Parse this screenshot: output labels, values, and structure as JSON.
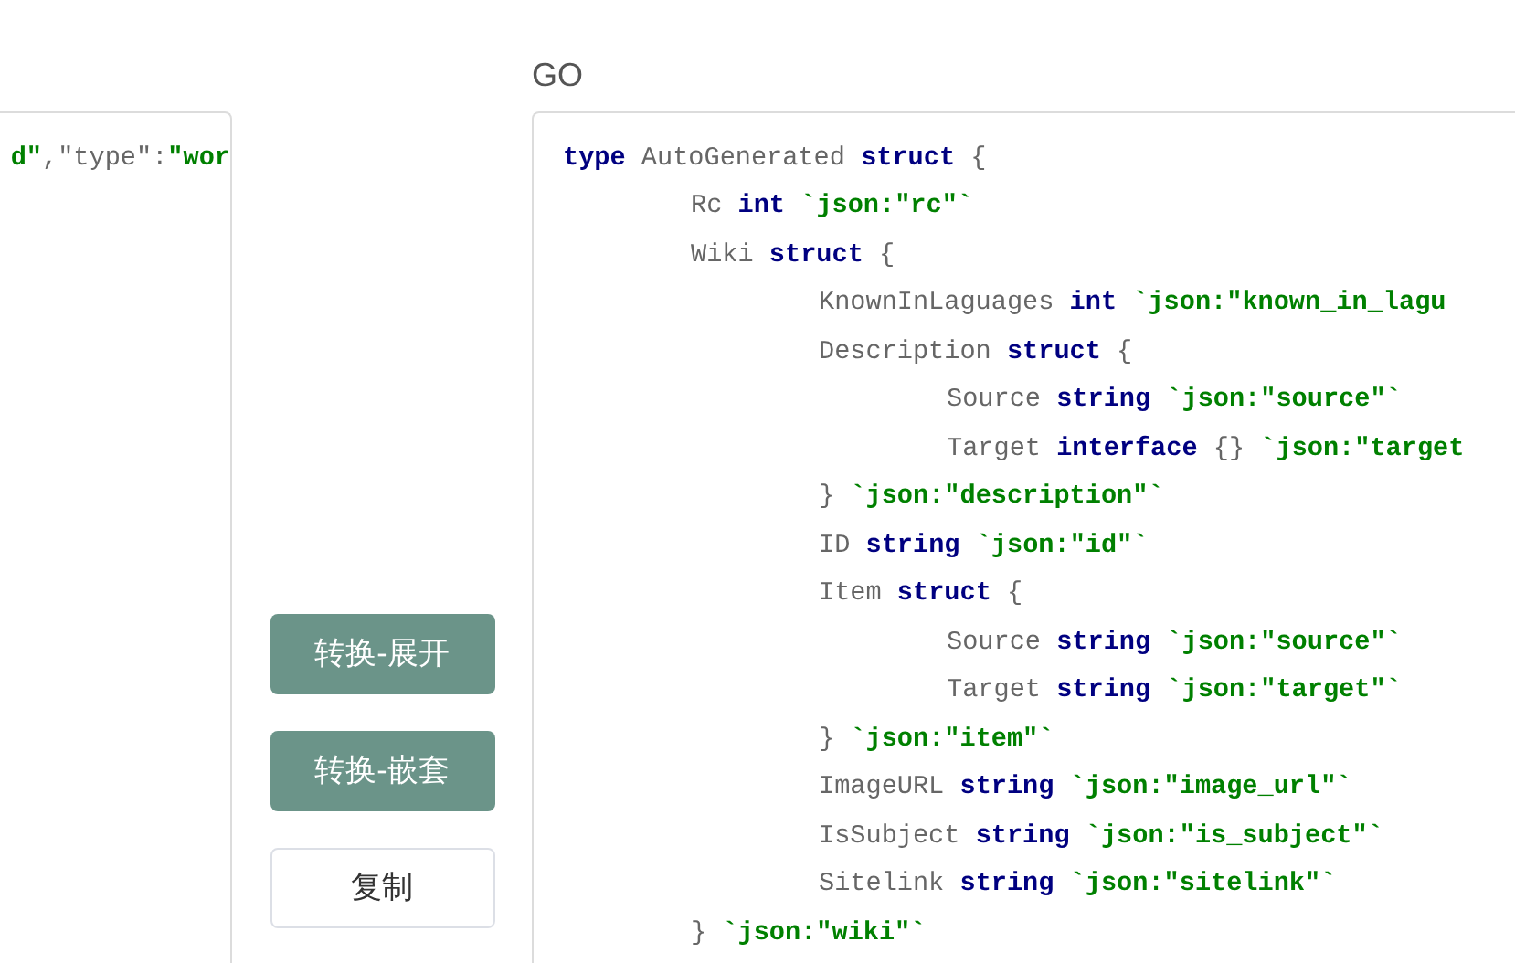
{
  "input_panel": {
    "tokens": [
      {
        "kind": "string",
        "text": "d\""
      },
      {
        "kind": "punct",
        "text": ","
      },
      {
        "kind": "name",
        "text": "\"type\""
      },
      {
        "kind": "punct",
        "text": ":"
      },
      {
        "kind": "string",
        "text": "\"wor"
      }
    ]
  },
  "buttons": [
    {
      "label": "转换-展开",
      "kind": "primary"
    },
    {
      "label": "转换-嵌套",
      "kind": "primary"
    },
    {
      "label": "复制",
      "kind": "secondary"
    }
  ],
  "output_panel": {
    "title": "GO",
    "lines": [
      {
        "tokens": [
          {
            "kind": "keyword",
            "text": "type"
          },
          {
            "kind": "name",
            "text": "AutoGenerated"
          },
          {
            "kind": "keyword",
            "text": "struct"
          },
          {
            "kind": "punct",
            "text": "{"
          }
        ],
        "children": [
          {
            "tokens": [
              {
                "kind": "name",
                "text": "Rc"
              },
              {
                "kind": "keyword",
                "text": "int"
              },
              {
                "kind": "tag",
                "text": "`json:\"rc\"`"
              }
            ]
          },
          {
            "tokens": [
              {
                "kind": "name",
                "text": "Wiki"
              },
              {
                "kind": "keyword",
                "text": "struct"
              },
              {
                "kind": "punct",
                "text": "{"
              }
            ],
            "children": [
              {
                "tokens": [
                  {
                    "kind": "name",
                    "text": "KnownInLaguages"
                  },
                  {
                    "kind": "keyword",
                    "text": "int"
                  },
                  {
                    "kind": "tag",
                    "text": "`json:\"known_in_lagu"
                  }
                ]
              },
              {
                "tokens": [
                  {
                    "kind": "name",
                    "text": "Description"
                  },
                  {
                    "kind": "keyword",
                    "text": "struct"
                  },
                  {
                    "kind": "punct",
                    "text": "{"
                  }
                ],
                "children": [
                  {
                    "tokens": [
                      {
                        "kind": "name",
                        "text": "Source"
                      },
                      {
                        "kind": "keyword",
                        "text": "string"
                      },
                      {
                        "kind": "tag",
                        "text": "`json:\"source\"`"
                      }
                    ]
                  },
                  {
                    "tokens": [
                      {
                        "kind": "name",
                        "text": "Target"
                      },
                      {
                        "kind": "keyword",
                        "text": "interface"
                      },
                      {
                        "kind": "punct",
                        "text": "{}"
                      },
                      {
                        "kind": "tag",
                        "text": "`json:\"target"
                      }
                    ]
                  }
                ]
              },
              {
                "tokens": [
                  {
                    "kind": "punct",
                    "text": "}"
                  },
                  {
                    "kind": "tag",
                    "text": "`json:\"description\"`"
                  }
                ]
              },
              {
                "tokens": [
                  {
                    "kind": "name",
                    "text": "ID"
                  },
                  {
                    "kind": "keyword",
                    "text": "string"
                  },
                  {
                    "kind": "tag",
                    "text": "`json:\"id\"`"
                  }
                ]
              },
              {
                "tokens": [
                  {
                    "kind": "name",
                    "text": "Item"
                  },
                  {
                    "kind": "keyword",
                    "text": "struct"
                  },
                  {
                    "kind": "punct",
                    "text": "{"
                  }
                ],
                "children": [
                  {
                    "tokens": [
                      {
                        "kind": "name",
                        "text": "Source"
                      },
                      {
                        "kind": "keyword",
                        "text": "string"
                      },
                      {
                        "kind": "tag",
                        "text": "`json:\"source\"`"
                      }
                    ]
                  },
                  {
                    "tokens": [
                      {
                        "kind": "name",
                        "text": "Target"
                      },
                      {
                        "kind": "keyword",
                        "text": "string"
                      },
                      {
                        "kind": "tag",
                        "text": "`json:\"target\"`"
                      }
                    ]
                  }
                ]
              },
              {
                "tokens": [
                  {
                    "kind": "punct",
                    "text": "}"
                  },
                  {
                    "kind": "tag",
                    "text": "`json:\"item\"`"
                  }
                ]
              },
              {
                "tokens": [
                  {
                    "kind": "name",
                    "text": "ImageURL"
                  },
                  {
                    "kind": "keyword",
                    "text": "string"
                  },
                  {
                    "kind": "tag",
                    "text": "`json:\"image_url\"`"
                  }
                ]
              },
              {
                "tokens": [
                  {
                    "kind": "name",
                    "text": "IsSubject"
                  },
                  {
                    "kind": "keyword",
                    "text": "string"
                  },
                  {
                    "kind": "tag",
                    "text": "`json:\"is_subject\"`"
                  }
                ]
              },
              {
                "tokens": [
                  {
                    "kind": "name",
                    "text": "Sitelink"
                  },
                  {
                    "kind": "keyword",
                    "text": "string"
                  },
                  {
                    "kind": "tag",
                    "text": "`json:\"sitelink\"`"
                  }
                ]
              }
            ]
          },
          {
            "tokens": [
              {
                "kind": "punct",
                "text": "}"
              },
              {
                "kind": "tag",
                "text": "`json:\"wiki\"`"
              }
            ]
          }
        ]
      }
    ]
  }
}
